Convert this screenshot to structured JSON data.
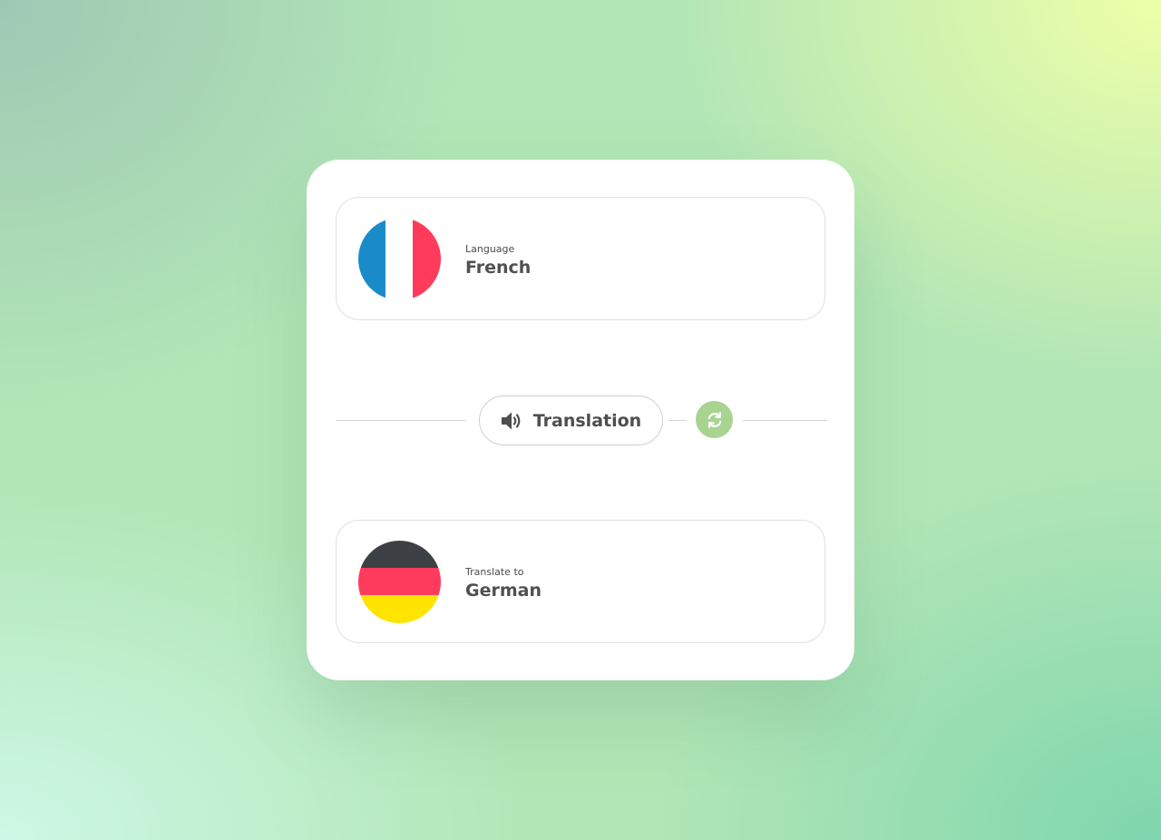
{
  "source": {
    "caption": "Language",
    "language": "French",
    "flag_icon": "france-flag-icon",
    "flag_colors": [
      "#1a8bc9",
      "#ffffff",
      "#ff3b5b"
    ]
  },
  "target": {
    "caption": "Translate to",
    "language": "German",
    "flag_icon": "germany-flag-icon",
    "flag_colors": [
      "#3d4045",
      "#ff3b5b",
      "#ffe400"
    ]
  },
  "controls": {
    "translation_label": "Translation",
    "speaker_icon": "speaker-icon",
    "swap_icon": "swap-icon",
    "swap_color": "#a8d391"
  }
}
